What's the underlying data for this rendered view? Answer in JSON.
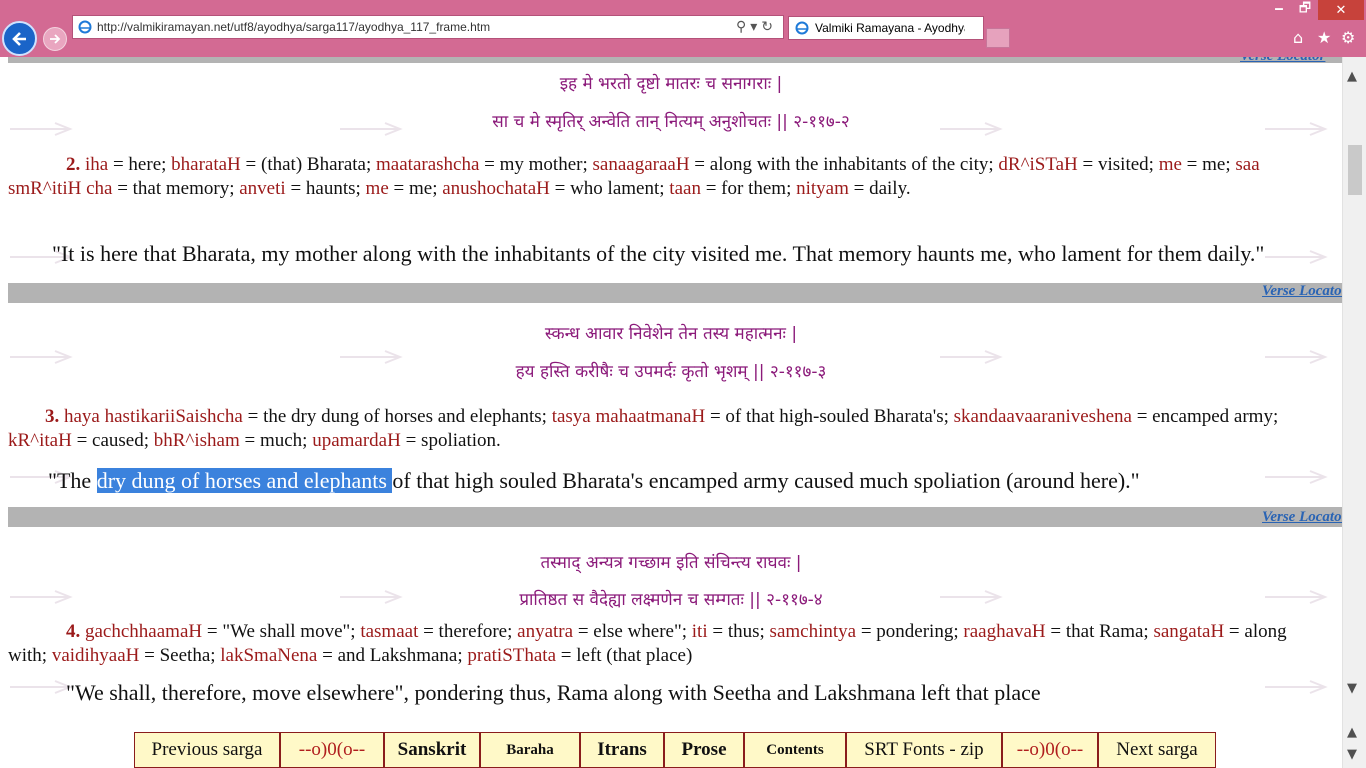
{
  "browser": {
    "url": "http://valmikiramayan.net/utf8/ayodhya/sarga117/ayodhya_117_frame.htm",
    "tab_title": "Valmiki Ramayana - Ayodhya Kanda",
    "window_controls": {
      "minimize": "🗕",
      "maximize": "🗗",
      "close": "✕"
    },
    "toolbar_icons": [
      "home-icon",
      "favorites-star-icon",
      "settings-gear-icon"
    ]
  },
  "verse_locator_label": "Verse Locator",
  "verses": [
    {
      "number": "2",
      "sanskrit_line1": "इह मे भरतो दृष्टो मातरः च सनागराः |",
      "sanskrit_line2": "सा च मे स्मृतिर् अन्वेति तान् नित्यम् अनुशोचतः || २-११७-२",
      "wbw": [
        {
          "t": "iha",
          "m": " = here; "
        },
        {
          "t": "bharataH",
          "m": " = (that) Bharata; "
        },
        {
          "t": "maatarashcha",
          "m": " = my mother; "
        },
        {
          "t": "sanaagaraaH",
          "m": " = along with the inhabitants of the city; "
        },
        {
          "t": "dR^iSTaH",
          "m": " = visited; "
        },
        {
          "t": "me",
          "m": " = me; "
        },
        {
          "t": "saa smR^itiH cha",
          "m": " = that memory; "
        },
        {
          "t": "anveti",
          "m": " = haunts; "
        },
        {
          "t": "me",
          "m": " = me; "
        },
        {
          "t": "anushochataH",
          "m": " = who lament; "
        },
        {
          "t": "taan",
          "m": " = for them; "
        },
        {
          "t": "nityam",
          "m": " = daily."
        }
      ],
      "translation": "\"It is here that Bharata, my mother along with the inhabitants of the city visited me. That memory haunts me, who lament for them daily.\""
    },
    {
      "number": "3",
      "sanskrit_line1": "स्कन्ध आवार निवेशेन तेन तस्य महात्मनः |",
      "sanskrit_line2": "हय हस्ति करीषैः च उपमर्दः कृतो भृशम् || २-११७-३",
      "wbw": [
        {
          "t": "haya hastikariiSaishcha",
          "m": " = the dry dung of horses and elephants; "
        },
        {
          "t": "tasya mahaatmanaH",
          "m": " = of that high-souled Bharata's; "
        },
        {
          "t": "skandaavaaraniveshena",
          "m": " = encamped army; "
        },
        {
          "t": "kR^itaH",
          "m": " = caused; "
        },
        {
          "t": "bhR^isham",
          "m": " = much; "
        },
        {
          "t": "upamardaH",
          "m": " = spoliation."
        }
      ],
      "translation_before": "\"The ",
      "translation_highlight": "dry dung of horses and elephants ",
      "translation_after": "of that high souled Bharata's encamped army caused much spoliation (around here).\""
    },
    {
      "number": "4",
      "sanskrit_line1": "तस्माद् अन्यत्र गच्छाम इति संचिन्त्य राघवः |",
      "sanskrit_line2": "प्रातिष्ठत स वैदेह्या लक्ष्मणेन च सम्गतः || २-११७-४",
      "wbw": [
        {
          "t": "gachchhaamaH",
          "m": " = \"We shall move\"; "
        },
        {
          "t": "tasmaat",
          "m": " = therefore; "
        },
        {
          "t": "anyatra",
          "m": " = else where\"; "
        },
        {
          "t": "iti",
          "m": " = thus; "
        },
        {
          "t": "samchintya",
          "m": " = pondering; "
        },
        {
          "t": "raaghavaH",
          "m": " = that Rama; "
        },
        {
          "t": "sangataH",
          "m": " = along with; "
        },
        {
          "t": "vaidihyaaH",
          "m": " = Seetha; "
        },
        {
          "t": "lakSmaNena",
          "m": " = and Lakshmana; "
        },
        {
          "t": "pratiSThata",
          "m": " = left (that place)"
        }
      ],
      "translation": "\"We shall, therefore, move elsewhere\", pondering thus, Rama along with Seetha and Lakshmana left that place"
    }
  ],
  "bottom_nav": [
    {
      "label": "Previous sarga",
      "style": "normal"
    },
    {
      "label": "--o)0(o--",
      "style": "red"
    },
    {
      "label": "Sanskrit",
      "style": "bold"
    },
    {
      "label": "Baraha",
      "style": "bold"
    },
    {
      "label": "Itrans",
      "style": "bold"
    },
    {
      "label": "Prose",
      "style": "bold"
    },
    {
      "label": "Contents",
      "style": "bold"
    },
    {
      "label": "SRT Fonts - zip",
      "style": "normal"
    },
    {
      "label": "--o)0(o--",
      "style": "red"
    },
    {
      "label": "Next sarga",
      "style": "normal"
    }
  ]
}
